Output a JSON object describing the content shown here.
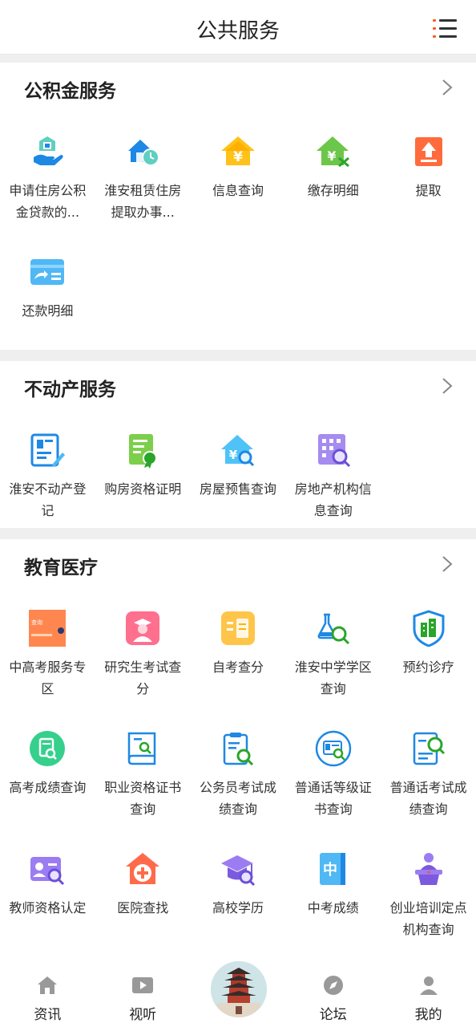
{
  "header": {
    "title": "公共服务",
    "menu_icon": "list-menu-icon"
  },
  "sections": [
    {
      "title": "公积金服务",
      "items": [
        {
          "label": "申请住房公积金贷款的...",
          "icon": "hand-house-icon"
        },
        {
          "label": "淮安租赁住房提取办事...",
          "icon": "house-clock-icon"
        },
        {
          "label": "信息查询",
          "icon": "house-yen-icon"
        },
        {
          "label": "缴存明细",
          "icon": "house-transfer-icon"
        },
        {
          "label": "提取",
          "icon": "upload-icon"
        },
        {
          "label": "还款明细",
          "icon": "card-transfer-icon"
        }
      ]
    },
    {
      "title": "不动产服务",
      "items": [
        {
          "label": "淮安不动产登记",
          "icon": "document-edit-icon"
        },
        {
          "label": "购房资格证明",
          "icon": "certificate-icon"
        },
        {
          "label": "房屋预售查询",
          "icon": "house-search-icon"
        },
        {
          "label": "房地产机构信息查询",
          "icon": "building-search-icon"
        }
      ]
    },
    {
      "title": "教育医疗",
      "items": [
        {
          "label": "中高考服务专区",
          "icon": "exam-banner-icon",
          "banner_text": "查询"
        },
        {
          "label": "研究生考试查分",
          "icon": "graduate-icon"
        },
        {
          "label": "自考查分",
          "icon": "list-card-icon"
        },
        {
          "label": "淮安中学学区查询",
          "icon": "flask-search-icon"
        },
        {
          "label": "预约诊疗",
          "icon": "shield-hospital-icon"
        },
        {
          "label": "高考成绩查询",
          "icon": "circle-document-icon"
        },
        {
          "label": "职业资格证书查询",
          "icon": "book-search-icon"
        },
        {
          "label": "公务员考试成绩查询",
          "icon": "clipboard-search-icon"
        },
        {
          "label": "普通话等级证书查询",
          "icon": "id-card-search-icon"
        },
        {
          "label": "普通话考试成绩查询",
          "icon": "exam-doc-search-icon"
        },
        {
          "label": "教师资格认定",
          "icon": "teacher-card-icon"
        },
        {
          "label": "医院查找",
          "icon": "hospital-icon"
        },
        {
          "label": "高校学历",
          "icon": "mortarboard-icon"
        },
        {
          "label": "中考成绩",
          "icon": "book-zhong-icon",
          "glyph": "中"
        },
        {
          "label": "创业培训定点机构查询",
          "icon": "podium-person-icon"
        }
      ]
    }
  ],
  "bottom_nav": [
    {
      "label": "资讯",
      "icon": "home-icon"
    },
    {
      "label": "视听",
      "icon": "video-icon"
    },
    {
      "label": "",
      "icon": "pagoda-logo-icon"
    },
    {
      "label": "论坛",
      "icon": "compass-icon"
    },
    {
      "label": "我的",
      "icon": "user-icon"
    }
  ],
  "colors": {
    "accent": "#ff5a1f",
    "blue": "#1e88e5",
    "text": "#333333"
  }
}
